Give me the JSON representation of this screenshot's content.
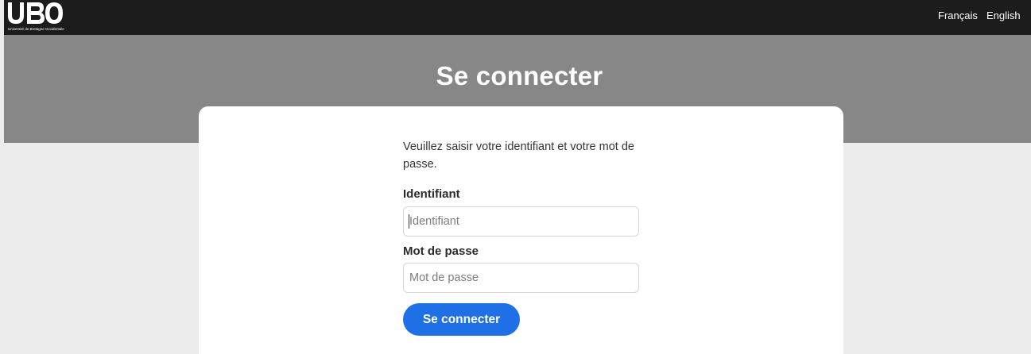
{
  "header": {
    "logo": {
      "mark_text": "UBO",
      "subtitle": "Université de Bretagne Occidentale"
    },
    "languages": [
      "Français",
      "English"
    ]
  },
  "page_title": "Se connecter",
  "form": {
    "intro": "Veuillez saisir votre identifiant et votre mot de passe.",
    "username": {
      "label": "Identifiant",
      "placeholder": "Identifiant",
      "value": ""
    },
    "password": {
      "label": "Mot de passe",
      "placeholder": "Mot de passe",
      "value": ""
    },
    "submit_label": "Se connecter"
  },
  "colors": {
    "navbar": "#1c1c1c",
    "banner": "#878787",
    "background": "#ececec",
    "primary_button": "#1f6fe6"
  }
}
